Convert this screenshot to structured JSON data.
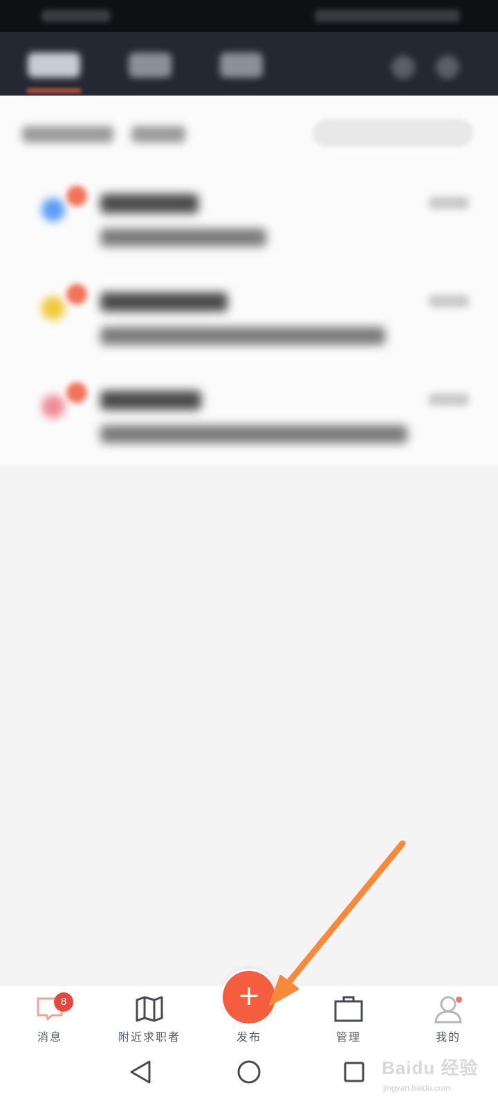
{
  "tabbar": {
    "items": [
      {
        "label": "消息",
        "icon": "chat-bubble-icon",
        "badge": "8"
      },
      {
        "label": "附近求职者",
        "icon": "map-icon"
      },
      {
        "label": "发布",
        "icon": "plus-icon"
      },
      {
        "label": "管理",
        "icon": "briefcase-icon"
      },
      {
        "label": "我的",
        "icon": "person-icon"
      }
    ],
    "publish_symbol": "+"
  },
  "system_nav": {
    "icons": [
      "back-triangle-icon",
      "home-circle-icon",
      "recents-square-icon"
    ]
  },
  "watermark": {
    "logo": "Baidu 经验",
    "url": "jingyan.baidu.com"
  },
  "colors": {
    "accent": "#f45d3e",
    "arrow": "#f68a3a",
    "nav_bg": "#232833",
    "badge": "#e8473f"
  }
}
